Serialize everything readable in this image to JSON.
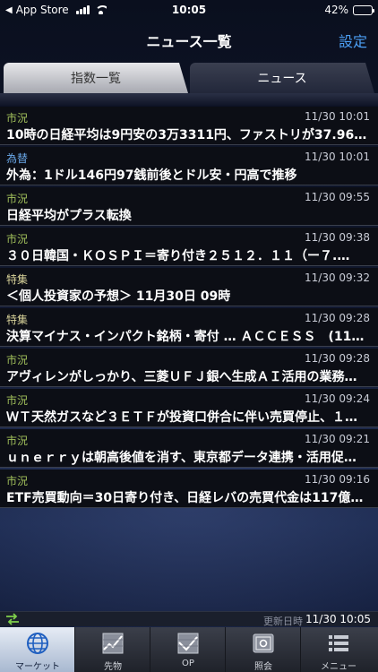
{
  "status_bar": {
    "back_app": "App Store",
    "time": "10:05",
    "battery": "42%",
    "battery_level": 0.42
  },
  "nav": {
    "title": "ニュース一覧",
    "settings": "設定"
  },
  "tabs": {
    "left": "指数一覧",
    "right": "ニュース"
  },
  "news": [
    {
      "category": "市況",
      "time": "11/30 10:01",
      "title": "10時の日経平均は9円安の3万3311円、ファストリが37.96…"
    },
    {
      "category": "為替",
      "time": "11/30 10:01",
      "title": "外為：1ドル146円97銭前後とドル安・円高で推移"
    },
    {
      "category": "市況",
      "time": "11/30 09:55",
      "title": "日経平均がプラス転換"
    },
    {
      "category": "市況",
      "time": "11/30 09:38",
      "title": "３０日韓国・ＫＯＳＰＩ＝寄り付き２５１２．１１（ー７.…"
    },
    {
      "category": "特集",
      "time": "11/30 09:32",
      "title": "＜個人投資家の予想＞ 11月30日 09時"
    },
    {
      "category": "特集",
      "time": "11/30 09:28",
      "title": "決算マイナス・インパクト銘柄・寄付 … ＡＣＣＥＳＳ　(11…"
    },
    {
      "category": "市況",
      "time": "11/30 09:28",
      "title": "アヴィレンがしっかり、三菱ＵＦＪ銀へ生成ＡＩ活用の業務…"
    },
    {
      "category": "市況",
      "time": "11/30 09:24",
      "title": "ＷＴ天然ガスなど３ＥＴＦが投資口併合に伴い売買停止、１…"
    },
    {
      "category": "市況",
      "time": "11/30 09:21",
      "title": "ｕｎｅｒｒｙは朝高後値を消す、東京都データ連携・活用促…"
    },
    {
      "category": "市況",
      "time": "11/30 09:16",
      "title": "ETF売買動向＝30日寄り付き、日経レバの売買代金は117億…"
    }
  ],
  "update": {
    "label": "更新日時",
    "value": "11/30 10:05"
  },
  "tabbar": [
    {
      "label": "マーケット",
      "icon": "globe-icon"
    },
    {
      "label": "先物",
      "icon": "futures-chart-icon"
    },
    {
      "label": "OP",
      "icon": "options-chart-icon"
    },
    {
      "label": "照会",
      "icon": "safe-icon"
    },
    {
      "label": "メニュー",
      "icon": "menu-list-icon"
    }
  ],
  "colors": {
    "accent": "#4c9ff5",
    "category_market": "#a3c25c",
    "category_fx": "#6aa8e8",
    "category_special": "#d9d39a"
  }
}
